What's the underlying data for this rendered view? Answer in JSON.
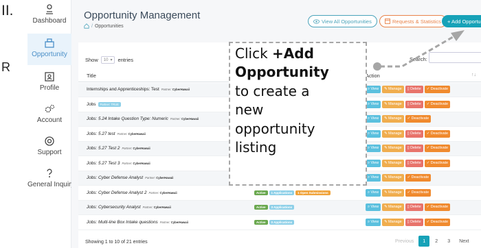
{
  "slide": {
    "marker": "II.",
    "stray_letter": "R"
  },
  "sidebar": {
    "items": [
      {
        "label": "Dashboard",
        "icon": "dashboard-icon",
        "active": false
      },
      {
        "label": "Opportunity",
        "icon": "opportunity-icon",
        "active": true
      },
      {
        "label": "Profile",
        "icon": "profile-icon",
        "active": false
      },
      {
        "label": "Account",
        "icon": "account-gear-icon",
        "active": false
      },
      {
        "label": "Support",
        "icon": "support-icon",
        "active": false
      },
      {
        "label": "General Inquiry",
        "icon": "question-icon",
        "active": false
      }
    ]
  },
  "header": {
    "title": "Opportunity Management",
    "breadcrumb": "Opportunities",
    "buttons": {
      "view_all": "View All Opportunities",
      "requests": "Requests & Statistics",
      "add": "+ Add Opportunity"
    }
  },
  "table": {
    "show_label": "Show",
    "entries_label": "entries",
    "page_size": "10",
    "search_label": "Search:",
    "col_title": "Title",
    "col_action": "Action",
    "sort_glyph": "↑↓",
    "partner_prefix": "Partner:",
    "rows": [
      {
        "title": "Internships and Apprenticeships: Test",
        "partner": "CyberHawaii",
        "italic": false,
        "status": [],
        "actions": [
          "View",
          "Manage",
          "Delete",
          "Deactivate"
        ]
      },
      {
        "title": "Jobs",
        "partner_badge": "Partner: TRUE",
        "italic": false,
        "status": [],
        "actions": [
          "View",
          "Manage",
          "Delete",
          "Deactivate"
        ]
      },
      {
        "title": "Jobs: 5.24 Intake Question Type: Numeric",
        "partner": "CyberHawaii",
        "italic": true,
        "status": [],
        "actions": [
          "View",
          "Manage",
          "Deactivate"
        ]
      },
      {
        "title": "Jobs: 5.27 test",
        "partner": "CyberHawaii",
        "italic": true,
        "status": [],
        "actions": [
          "View",
          "Manage",
          "Delete",
          "Deactivate"
        ]
      },
      {
        "title": "Jobs: 5.27 Test 2",
        "partner": "CyberHawaii",
        "italic": true,
        "status": [],
        "actions": [
          "View",
          "Manage",
          "Delete",
          "Deactivate"
        ]
      },
      {
        "title": "Jobs: 5.27 Test 3",
        "partner": "CyberHawaii",
        "italic": true,
        "status": [],
        "actions": [
          "View",
          "Manage",
          "Delete",
          "Deactivate"
        ]
      },
      {
        "title": "Jobs: Cyber Defense Analyst",
        "partner": "CyberHawaii",
        "italic": true,
        "status": [],
        "actions": [
          "View",
          "Manage",
          "Deactivate"
        ]
      },
      {
        "title": "Jobs: Cyber Defense Analyst 2",
        "partner": "CyberHawaii",
        "italic": true,
        "status": [
          "Active",
          "1 Applications",
          "1 Open Submissions"
        ],
        "actions": [
          "View",
          "Manage",
          "Deactivate"
        ]
      },
      {
        "title": "Jobs: Cybersecurity Analyst",
        "partner": "CyberHawaii",
        "italic": true,
        "status": [
          "Active",
          "3 Applications"
        ],
        "actions": [
          "View",
          "Manage",
          "Delete",
          "Deactivate"
        ]
      },
      {
        "title": "Jobs: Multi-line Box Intake questions",
        "partner": "CyberHawaii",
        "italic": true,
        "status": [
          "Active",
          "0 Applications"
        ],
        "actions": [
          "View",
          "Manage",
          "Delete",
          "Deactivate"
        ]
      }
    ],
    "info": "Showing 1 to 10 of 21 entries",
    "pager": {
      "previous": "Previous",
      "pages": [
        "1",
        "2",
        "3"
      ],
      "current": "1",
      "next": "Next"
    }
  },
  "callout": {
    "line1_prefix": "Click ",
    "line1_bold": "+Add",
    "line2_bold": "Opportunity",
    "rest": "to create a\nnew\nopportunity\nlisting"
  },
  "colors": {
    "accent": "#17a2b8",
    "view": "#5bc0de",
    "manage": "#f0ad4e",
    "delete": "#e8736b",
    "deactivate": "#f08a2e",
    "active_badge": "#6aa84f",
    "sidebar_active": "#e9f3fb"
  }
}
